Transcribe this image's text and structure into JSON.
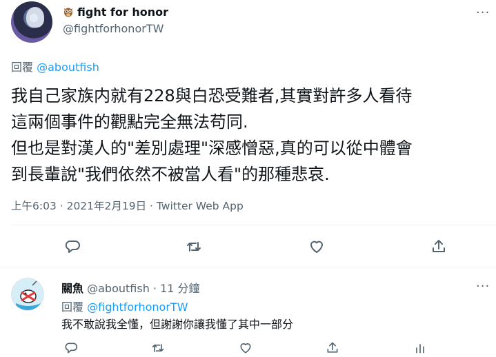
{
  "tweet": {
    "display_name": "fight for honor",
    "handle": "@fightforhonorTW",
    "replying_label": "回覆",
    "replying_to": "@aboutfish",
    "text": "我自己家族内就有228與白恐受難者,其實對許多人看待\n這兩個事件的觀點完全無法苟同.\n但也是對漢人的\"差別處理\"深感憎惡,真的可以從中體會\n到長輩說\"我們依然不被當人看\"的那種悲哀.",
    "timestamp": "上午6:03 · 2021年2月19日 · Twitter Web App",
    "more": "···"
  },
  "actions": {
    "icons": [
      "reply-icon",
      "retweet-icon",
      "like-icon",
      "share-icon"
    ]
  },
  "reply": {
    "display_name": "關魚",
    "handle": "@aboutfish",
    "time": "· 11 分鐘",
    "replying_label": "回覆",
    "replying_to": "@fightforhonorTW",
    "text": "我不敢說我全懂，但謝謝你讓我懂了其中一部分",
    "more": "···",
    "icons": [
      "reply-icon",
      "retweet-icon",
      "like-icon",
      "share-icon",
      "analytics-icon"
    ]
  },
  "colors": {
    "accent": "#1d9bf0",
    "secondary_text": "#536471",
    "divider": "#eff3f4"
  }
}
